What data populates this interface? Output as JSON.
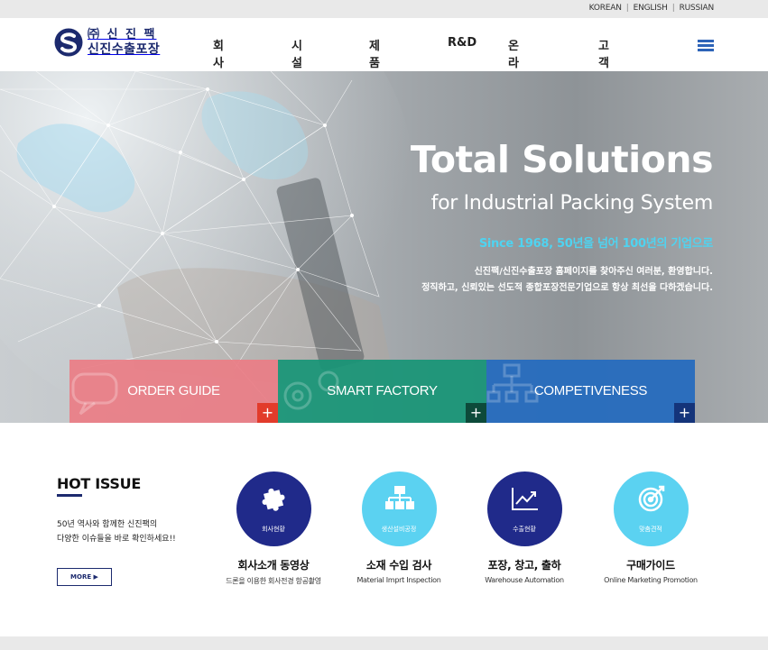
{
  "languages": [
    "KOREAN",
    "ENGLISH",
    "RUSSIAN"
  ],
  "logo": {
    "line1": "㈜ 신 진 팩",
    "line2": "신진수출포장"
  },
  "nav": {
    "items": [
      "회사소개",
      "시설현황",
      "제품소개",
      "R&D",
      "온라인견적",
      "고객지원"
    ]
  },
  "hero": {
    "title": "Total Solutions",
    "subtitle": "for Industrial Packing System",
    "since": "Since 1968, 50년을 넘어 100년의 기업으로",
    "desc_line1": "신진팩/신진수출포장 홈페이지를 찾아주신 여러분, 환영합니다.",
    "desc_line2": "정직하고, 신뢰있는 선도적 종합포장전문기업으로 항상 최선을 다하겠습니다."
  },
  "tiles": [
    {
      "label": "ORDER GUIDE",
      "plus": "+"
    },
    {
      "label": "SMART FACTORY",
      "plus": "+"
    },
    {
      "label": "COMPETIVENESS",
      "plus": "+"
    }
  ],
  "hot_issue": {
    "title": "HOT ISSUE",
    "desc_line1": "50년 역사와 함께한 신진팩의",
    "desc_line2": "다양한 이슈들을 바로 확인하세요!!",
    "more": "MORE ▶"
  },
  "cards": [
    {
      "icon": "puzzle-icon",
      "circle_label": "회사현황",
      "title": "회사소개 동영상",
      "sub": "드론을 이용한 회사전경 항공촬영"
    },
    {
      "icon": "sitemap-icon",
      "circle_label": "생산설비공정",
      "title": "소재 수입 검사",
      "sub": "Material Imprt Inspection"
    },
    {
      "icon": "chart-icon",
      "circle_label": "수출현황",
      "title": "포장, 창고, 출하",
      "sub": "Warehouse Automation"
    },
    {
      "icon": "target-icon",
      "circle_label": "맞춤견적",
      "title": "구매가이드",
      "sub": "Online Marketing Promotion"
    }
  ],
  "colors": {
    "brand_navy": "#1c2a6e",
    "accent_cyan": "#4fd3f0",
    "tile_pink": "#ea7d86",
    "tile_green": "#179576",
    "tile_blue": "#266cbe"
  }
}
